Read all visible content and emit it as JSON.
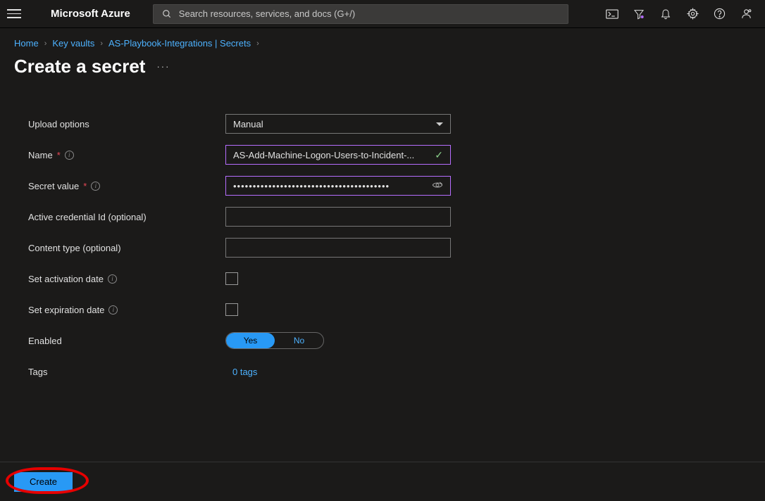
{
  "header": {
    "brand": "Microsoft Azure",
    "search_placeholder": "Search resources, services, and docs (G+/)"
  },
  "breadcrumb": {
    "items": [
      "Home",
      "Key vaults",
      "AS-Playbook-Integrations | Secrets"
    ]
  },
  "page": {
    "title": "Create a secret"
  },
  "form": {
    "upload_options": {
      "label": "Upload options",
      "value": "Manual"
    },
    "name": {
      "label": "Name",
      "value": "AS-Add-Machine-Logon-Users-to-Incident-..."
    },
    "secret_value": {
      "label": "Secret value",
      "value": "••••••••••••••••••••••••••••••••••••••••"
    },
    "active_credential_id": {
      "label": "Active credential Id (optional)",
      "value": ""
    },
    "content_type": {
      "label": "Content type (optional)",
      "value": ""
    },
    "set_activation_date": {
      "label": "Set activation date",
      "checked": false
    },
    "set_expiration_date": {
      "label": "Set expiration date",
      "checked": false
    },
    "enabled": {
      "label": "Enabled",
      "yes": "Yes",
      "no": "No",
      "value": true
    },
    "tags": {
      "label": "Tags",
      "link": "0 tags"
    }
  },
  "actions": {
    "create": "Create"
  }
}
